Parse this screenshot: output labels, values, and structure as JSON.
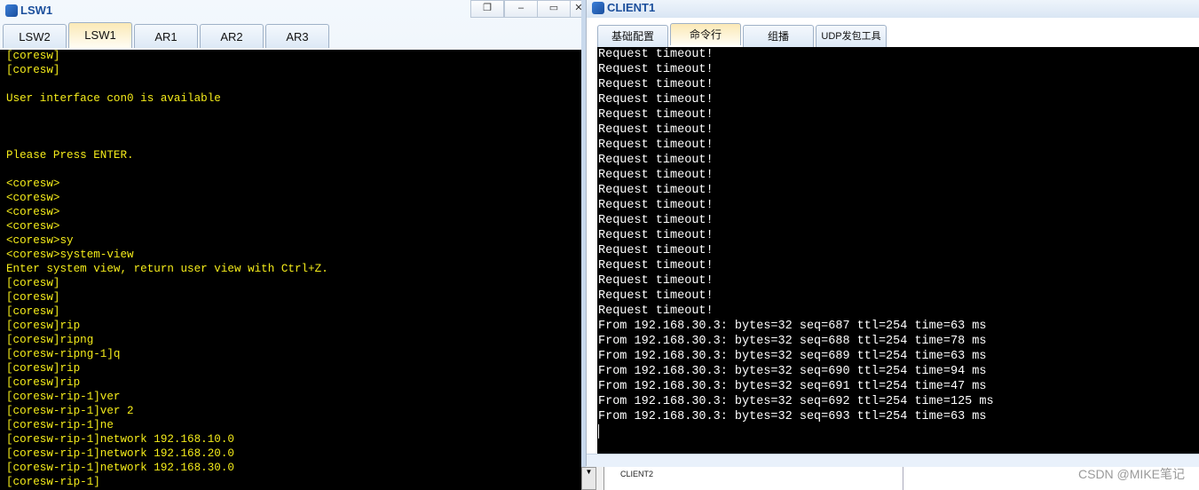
{
  "lsw_window": {
    "title": "LSW1",
    "controls": [
      "restore",
      "minimize",
      "maximize",
      "close"
    ],
    "tabs": [
      {
        "label": "LSW2"
      },
      {
        "label": "LSW1",
        "active": true
      },
      {
        "label": "AR1"
      },
      {
        "label": "AR2"
      },
      {
        "label": "AR3"
      }
    ],
    "terminal_color": "#f5ec1a",
    "lines": [
      "[coresw]",
      "[coresw]",
      "",
      "User interface con0 is available",
      "",
      "",
      "",
      "Please Press ENTER.",
      "",
      "<coresw>",
      "<coresw>",
      "<coresw>",
      "<coresw>",
      "<coresw>sy",
      "<coresw>system-view",
      "Enter system view, return user view with Ctrl+Z.",
      "[coresw]",
      "[coresw]",
      "[coresw]",
      "[coresw]rip",
      "[coresw]ripng",
      "[coresw-ripng-1]q",
      "[coresw]rip",
      "[coresw]rip",
      "[coresw-rip-1]ver",
      "[coresw-rip-1]ver 2",
      "[coresw-rip-1]ne",
      "[coresw-rip-1]network 192.168.10.0",
      "[coresw-rip-1]network 192.168.20.0",
      "[coresw-rip-1]network 192.168.30.0",
      "[coresw-rip-1]"
    ]
  },
  "client_window": {
    "title": "CLIENT1",
    "tabs": [
      {
        "label": "基础配置"
      },
      {
        "label": "命令行",
        "active": true
      },
      {
        "label": "组播"
      },
      {
        "label": "UDP发包工具"
      }
    ],
    "lines": [
      "Request timeout!",
      "Request timeout!",
      "Request timeout!",
      "Request timeout!",
      "Request timeout!",
      "Request timeout!",
      "Request timeout!",
      "Request timeout!",
      "Request timeout!",
      "Request timeout!",
      "Request timeout!",
      "Request timeout!",
      "Request timeout!",
      "Request timeout!",
      "Request timeout!",
      "Request timeout!",
      "Request timeout!",
      "Request timeout!",
      "From 192.168.30.3: bytes=32 seq=687 ttl=254 time=63 ms",
      "From 192.168.30.3: bytes=32 seq=688 ttl=254 time=78 ms",
      "From 192.168.30.3: bytes=32 seq=689 ttl=254 time=63 ms",
      "From 192.168.30.3: bytes=32 seq=690 ttl=254 time=94 ms",
      "From 192.168.30.3: bytes=32 seq=691 ttl=254 time=47 ms",
      "From 192.168.30.3: bytes=32 seq=692 ttl=254 time=125 ms",
      "From 192.168.30.3: bytes=32 seq=693 ttl=254 time=63 ms"
    ]
  },
  "bottom_list": {
    "item": "CLIENT2"
  },
  "watermark": "CSDN @MIKE笔记"
}
